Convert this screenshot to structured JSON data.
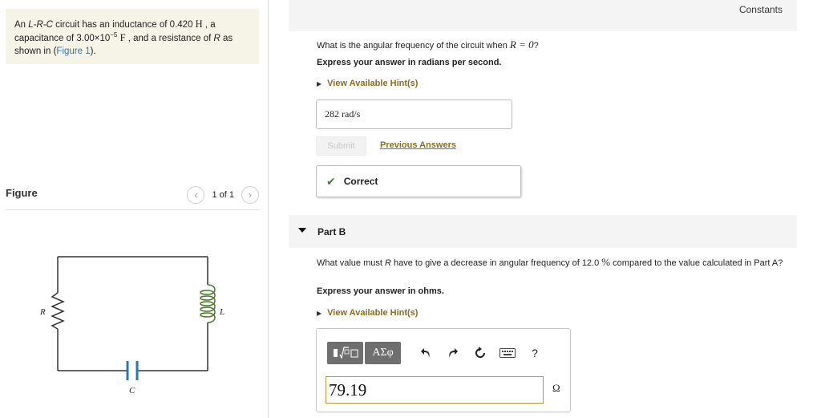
{
  "problem": {
    "part1": "An ",
    "circuit_type": "L-R-C",
    "part2": " circuit has an inductance of 0.420 ",
    "inductance_unit": "H",
    "part3": " , a",
    "part4": "capacitance of 3.00×10",
    "cap_exp": "−5",
    "cap_unit": "F",
    "part5": " , and a resistance of ",
    "r_symbol": "R",
    "part6": " as",
    "part7": "shown in (",
    "figure_link": "Figure 1",
    "part8": ")."
  },
  "figure": {
    "title": "Figure",
    "pager": "1 of 1",
    "prev_icon": "chevron-left-icon",
    "next_icon": "chevron-right-icon",
    "labels": {
      "r": "R",
      "l": "L",
      "c": "C"
    }
  },
  "header": {
    "constants": "Constants"
  },
  "part_a": {
    "question_pre": "What is the angular frequency of the circuit when ",
    "question_math": "R = 0",
    "question_post": "?",
    "instruction": "Express your answer in radians per second.",
    "hint": "View Available Hint(s)",
    "answer": "282  rad/s",
    "submit": "Submit",
    "previous_answers": "Previous Answers",
    "result": "Correct"
  },
  "part_b": {
    "label": "Part B",
    "question_1": "What value must ",
    "question_r": "R",
    "question_2": " have to give a decrease in angular frequency of 12.0 ",
    "question_pct": "%",
    "question_3": " compared to the value calculated in Part A?",
    "instruction": "Express your answer in ohms.",
    "hint": "View Available Hint(s)",
    "toolbar": {
      "greek": "ΑΣφ",
      "help": "?",
      "icons": [
        "templates-icon",
        "undo-icon",
        "redo-icon",
        "reset-icon",
        "keyboard-icon",
        "help-icon"
      ]
    },
    "input_value": "79.19",
    "unit": "Ω"
  },
  "colors": {
    "problem_bg": "#f6f3e7",
    "link": "#2e73b8",
    "hint_gold": "#8a6d1f",
    "correct_green": "#2e8b2e",
    "toolbar_gray": "#6f6f6f"
  }
}
